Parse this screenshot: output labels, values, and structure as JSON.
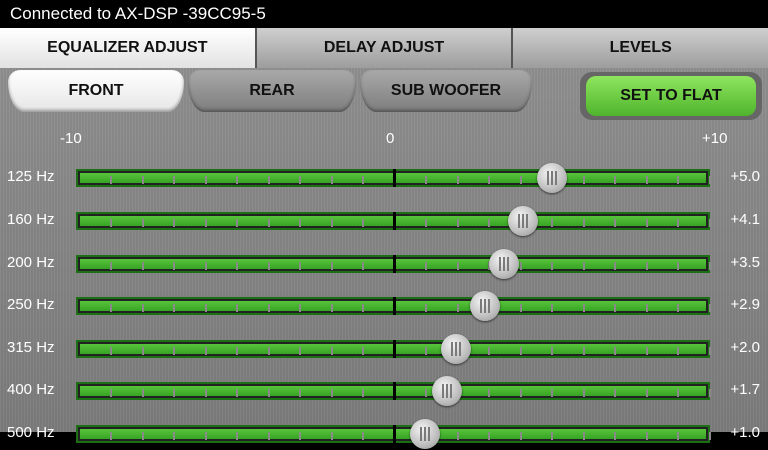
{
  "status": {
    "connection_text": "Connected to AX-DSP -39CC95-5"
  },
  "main_tabs": [
    {
      "label": "EQUALIZER ADJUST",
      "active": true
    },
    {
      "label": "DELAY ADJUST",
      "active": false
    },
    {
      "label": "LEVELS",
      "active": false
    }
  ],
  "sub_tabs": [
    {
      "label": "FRONT",
      "active": true
    },
    {
      "label": "REAR",
      "active": false
    },
    {
      "label": "SUB WOOFER",
      "active": false
    }
  ],
  "set_flat_label": "SET TO FLAT",
  "scale": {
    "min_label": "-10",
    "mid_label": "0",
    "max_label": "+10",
    "min": -10,
    "max": 10
  },
  "bands": [
    {
      "label": "125 Hz",
      "value_text": "+5.0",
      "value": 5.0
    },
    {
      "label": "160 Hz",
      "value_text": "+4.1",
      "value": 4.1
    },
    {
      "label": "200 Hz",
      "value_text": "+3.5",
      "value": 3.5
    },
    {
      "label": "250 Hz",
      "value_text": "+2.9",
      "value": 2.9
    },
    {
      "label": "315 Hz",
      "value_text": "+2.0",
      "value": 2.0
    },
    {
      "label": "400 Hz",
      "value_text": "+1.7",
      "value": 1.7
    },
    {
      "label": "500 Hz",
      "value_text": "+1.0",
      "value": 1.0
    }
  ],
  "colors": {
    "accent_green": "#4fb42c",
    "track_green": "#36a324"
  }
}
